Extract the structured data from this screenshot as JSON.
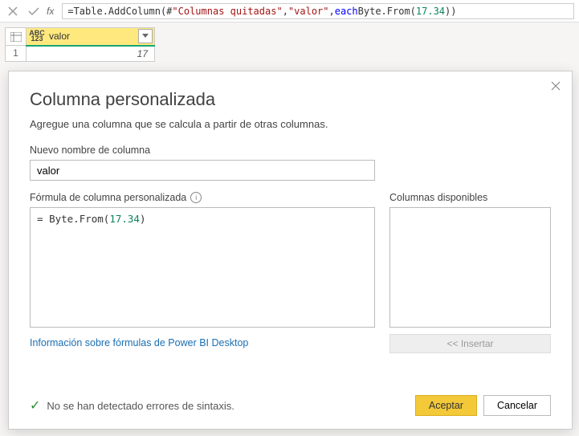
{
  "formula_bar": {
    "formula_tokens": {
      "prefix": "= ",
      "fn1": "Table.AddColumn",
      "open1": "(#",
      "str1": "\"Columnas quitadas\"",
      "sep1": ", ",
      "str2": "\"valor\"",
      "sep2": ", ",
      "kw_each": "each",
      "sp": " ",
      "fn2": "Byte.From",
      "open2": "(",
      "num": "17.34",
      "close": "))"
    }
  },
  "grid": {
    "type_label_top": "ABC",
    "type_label_bot": "123",
    "col_header": "valor",
    "row_num": "1",
    "cell_value": "17"
  },
  "dialog": {
    "title": "Columna personalizada",
    "subtitle": "Agregue una columna que se calcula a partir de otras columnas.",
    "new_col_label": "Nuevo nombre de columna",
    "new_col_value": "valor",
    "formula_label": "Fórmula de columna personalizada",
    "formula_tokens": {
      "prefix": "= ",
      "fn": "Byte.From",
      "open": "(",
      "num": "17.34",
      "close": ")"
    },
    "avail_label": "Columnas disponibles",
    "insert_label": "<< Insertar",
    "learn_link": "Información sobre fórmulas de Power BI Desktop",
    "status_text": "No se han detectado errores de sintaxis.",
    "btn_ok": "Aceptar",
    "btn_cancel": "Cancelar"
  }
}
